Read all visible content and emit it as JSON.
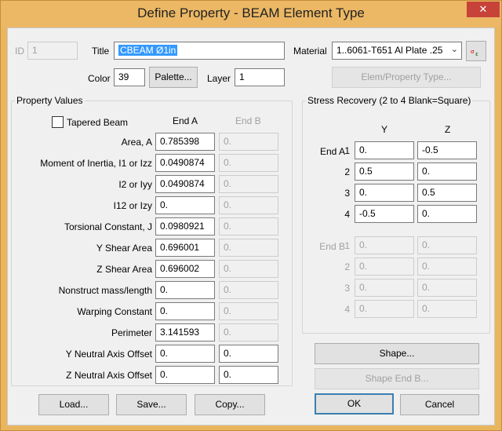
{
  "window": {
    "title": "Define Property - BEAM Element Type",
    "close_glyph": "✕"
  },
  "header": {
    "id_label": "ID",
    "id_value": "1",
    "title_label": "Title",
    "title_value": "CBEAM Ø1in",
    "material_label": "Material",
    "material_value": "1..6061-T651 Al Plate .25",
    "color_label": "Color",
    "color_value": "39",
    "palette_button": "Palette...",
    "layer_label": "Layer",
    "layer_value": "1",
    "elem_type_button": "Elem/Property Type..."
  },
  "property_values": {
    "group_title": "Property Values",
    "tapered_beam_label": "Tapered Beam",
    "tapered_beam_checked": false,
    "end_a_header": "End A",
    "end_b_header": "End B",
    "rows": [
      {
        "label": "Area,  A",
        "end_a": "0.785398",
        "end_b": "0.",
        "b_enabled": false
      },
      {
        "label": "Moment of Inertia,  I1 or Izz",
        "end_a": "0.0490874",
        "end_b": "0.",
        "b_enabled": false
      },
      {
        "label": "I2 or Iyy",
        "end_a": "0.0490874",
        "end_b": "0.",
        "b_enabled": false
      },
      {
        "label": "I12 or Izy",
        "end_a": "0.",
        "end_b": "0.",
        "b_enabled": false
      },
      {
        "label": "Torsional Constant,  J",
        "end_a": "0.0980921",
        "end_b": "0.",
        "b_enabled": false
      },
      {
        "label": "Y Shear Area",
        "end_a": "0.696001",
        "end_b": "0.",
        "b_enabled": false
      },
      {
        "label": "Z Shear Area",
        "end_a": "0.696002",
        "end_b": "0.",
        "b_enabled": false
      },
      {
        "label": "Nonstruct mass/length",
        "end_a": "0.",
        "end_b": "0.",
        "b_enabled": false
      },
      {
        "label": "Warping Constant",
        "end_a": "0.",
        "end_b": "0.",
        "b_enabled": false
      },
      {
        "label": "Perimeter",
        "end_a": "3.141593",
        "end_b": "0.",
        "b_enabled": false
      },
      {
        "label": "Y Neutral Axis Offset",
        "end_a": "0.",
        "end_b": "0.",
        "b_enabled": true
      },
      {
        "label": "Z Neutral Axis Offset",
        "end_a": "0.",
        "end_b": "0.",
        "b_enabled": true
      }
    ]
  },
  "stress_recovery": {
    "group_title": "Stress Recovery (2 to 4 Blank=Square)",
    "y_header": "Y",
    "z_header": "Z",
    "end_a_label": "End A",
    "end_b_label": "End B",
    "end_a_points": [
      {
        "num": "1",
        "y": "0.",
        "z": "-0.5"
      },
      {
        "num": "2",
        "y": "0.5",
        "z": "0."
      },
      {
        "num": "3",
        "y": "0.",
        "z": "0.5"
      },
      {
        "num": "4",
        "y": "-0.5",
        "z": "0."
      }
    ],
    "end_b_points": [
      {
        "num": "1",
        "y": "0.",
        "z": "0."
      },
      {
        "num": "2",
        "y": "0.",
        "z": "0."
      },
      {
        "num": "3",
        "y": "0.",
        "z": "0."
      },
      {
        "num": "4",
        "y": "0.",
        "z": "0."
      }
    ]
  },
  "buttons": {
    "shape": "Shape...",
    "shape_end_b": "Shape End B...",
    "load": "Load...",
    "save": "Save...",
    "copy": "Copy...",
    "ok": "OK",
    "cancel": "Cancel"
  }
}
